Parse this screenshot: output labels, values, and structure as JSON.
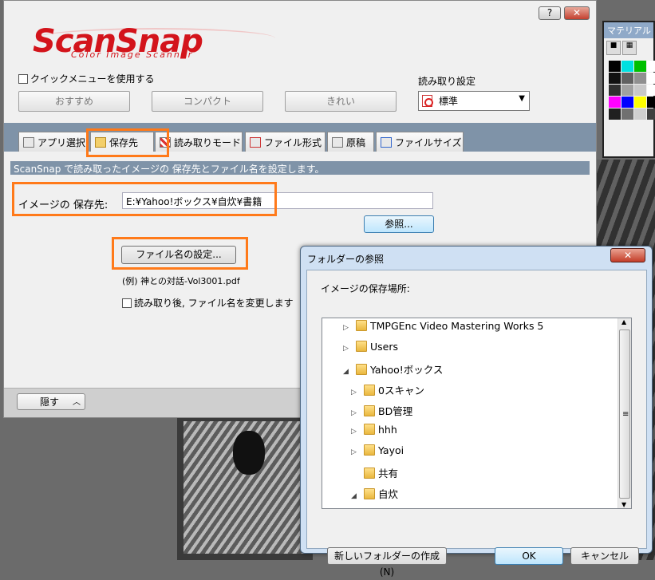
{
  "app": {
    "logo": "ScanSnap",
    "logo_sub": "Color Image Scanner",
    "help_btn": "?",
    "close_btn": "✕"
  },
  "palette": {
    "title": "マテリアル",
    "swatches": [
      "#000000",
      "#00e0e0",
      "#00c000",
      "#ffffff",
      "#111111",
      "#606060",
      "#909090",
      "#ffffff",
      "#303030",
      "#a0a0a0",
      "#c8c8c8",
      "#ffffff",
      "#ff00ff",
      "#0000ff",
      "#ffff00",
      "#000000",
      "#202020",
      "#707070",
      "#d0d0d0",
      "#404040"
    ]
  },
  "top": {
    "quick_menu_label": "クイックメニューを使用する",
    "quick_menu_checked": false,
    "read_settings_label": "読み取り設定",
    "presets": [
      "おすすめ",
      "コンパクト",
      "きれい"
    ],
    "read_select_value": "標準"
  },
  "tabs": [
    {
      "label": "アプリ選択"
    },
    {
      "label": "保存先"
    },
    {
      "label": "読み取りモード"
    },
    {
      "label": "ファイル形式"
    },
    {
      "label": "原稿"
    },
    {
      "label": "ファイルサイズ"
    }
  ],
  "active_tab": "保存先",
  "save_panel": {
    "description": "ScanSnap で読み取ったイメージの 保存先とファイル名を設定します。",
    "save_to_label": "イメージの 保存先:",
    "save_path": "E:¥Yahoo!ボックス¥自炊¥書籍",
    "browse_btn": "参照...",
    "filename_btn": "ファイル名の設定...",
    "filename_example": "(例) 神との対話-Vol3001.pdf",
    "rename_after_label": "読み取り後, ファイル名を変更します",
    "rename_after_checked": false
  },
  "bottom": {
    "hide_btn": "隠す",
    "hide_icon": "chevron-up-icon"
  },
  "dialog": {
    "title": "フォルダーの参照",
    "close": "✕",
    "prompt": "イメージの保存場所:",
    "tree": [
      {
        "label": "TMPGEnc Video Mastering Works 5",
        "state": "collapsed"
      },
      {
        "label": "Users",
        "state": "collapsed"
      },
      {
        "label": "Yahoo!ボックス",
        "state": "expanded"
      },
      {
        "label": "0スキャン",
        "state": "collapsed"
      },
      {
        "label": "BD管理",
        "state": "collapsed"
      },
      {
        "label": "hhh",
        "state": "collapsed"
      },
      {
        "label": "Yayoi",
        "state": "collapsed"
      },
      {
        "label": "共有",
        "state": "leaf"
      },
      {
        "label": "自炊",
        "state": "expanded"
      }
    ],
    "new_folder_btn": "新しいフォルダーの作成(N)",
    "ok_btn": "OK",
    "cancel_btn": "キャンセル"
  }
}
